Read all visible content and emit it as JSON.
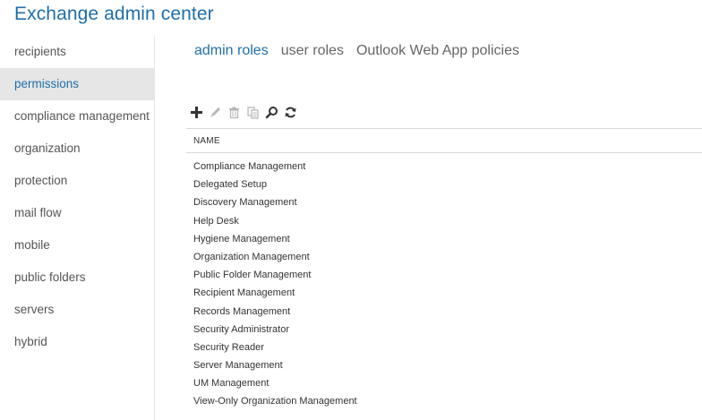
{
  "app": {
    "title": "Exchange admin center"
  },
  "sidebar": {
    "items": [
      {
        "label": "recipients"
      },
      {
        "label": "permissions"
      },
      {
        "label": "compliance management"
      },
      {
        "label": "organization"
      },
      {
        "label": "protection"
      },
      {
        "label": "mail flow"
      },
      {
        "label": "mobile"
      },
      {
        "label": "public folders"
      },
      {
        "label": "servers"
      },
      {
        "label": "hybrid"
      }
    ],
    "selected": "permissions"
  },
  "tabs": [
    {
      "label": "admin roles",
      "active": true
    },
    {
      "label": "user roles",
      "active": false
    },
    {
      "label": "Outlook Web App policies",
      "active": false
    }
  ],
  "toolbar": {
    "buttons": [
      {
        "icon": "plus-icon",
        "enabled": true
      },
      {
        "icon": "pencil-icon",
        "enabled": false
      },
      {
        "icon": "trash-icon",
        "enabled": false
      },
      {
        "icon": "copy-icon",
        "enabled": false
      },
      {
        "icon": "search-icon",
        "enabled": true
      },
      {
        "icon": "refresh-icon",
        "enabled": true
      }
    ]
  },
  "table": {
    "columns": [
      "NAME"
    ],
    "rows": [
      "Compliance Management",
      "Delegated Setup",
      "Discovery Management",
      "Help Desk",
      "Hygiene Management",
      "Organization Management",
      "Public Folder Management",
      "Recipient Management",
      "Records Management",
      "Security Administrator",
      "Security Reader",
      "Server Management",
      "UM Management",
      "View-Only Organization Management"
    ]
  },
  "colors": {
    "accent": "#1e6fa8",
    "selected_bg": "#e6e6e6",
    "icon_enabled": "#333333",
    "icon_disabled": "#b5b5b5"
  }
}
